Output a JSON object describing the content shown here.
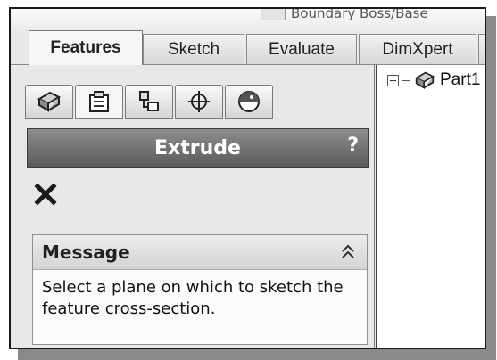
{
  "top_feature": {
    "label": "Boundary Boss/Base"
  },
  "command_manager": {
    "tabs": [
      {
        "label": "Features",
        "active": true
      },
      {
        "label": "Sketch",
        "active": false
      },
      {
        "label": "Evaluate",
        "active": false
      },
      {
        "label": "DimXpert",
        "active": false
      }
    ]
  },
  "panel_tabs": [
    {
      "icon": "featuremanager-icon"
    },
    {
      "icon": "propertymanager-icon"
    },
    {
      "icon": "configurationmanager-icon"
    },
    {
      "icon": "dimxpertmanager-icon"
    },
    {
      "icon": "display-manager-icon"
    }
  ],
  "property_manager": {
    "title": "Extrude",
    "help": "?",
    "close_icon": "close-icon",
    "message": {
      "heading": "Message",
      "collapse_icon": "double-chevron-up-icon",
      "text": "Select a plane on which to sketch the feature cross-section."
    }
  },
  "feature_tree": {
    "items": [
      {
        "label": "Part1",
        "icon": "part-icon",
        "expand_icon": "plus-expand-icon"
      }
    ]
  }
}
